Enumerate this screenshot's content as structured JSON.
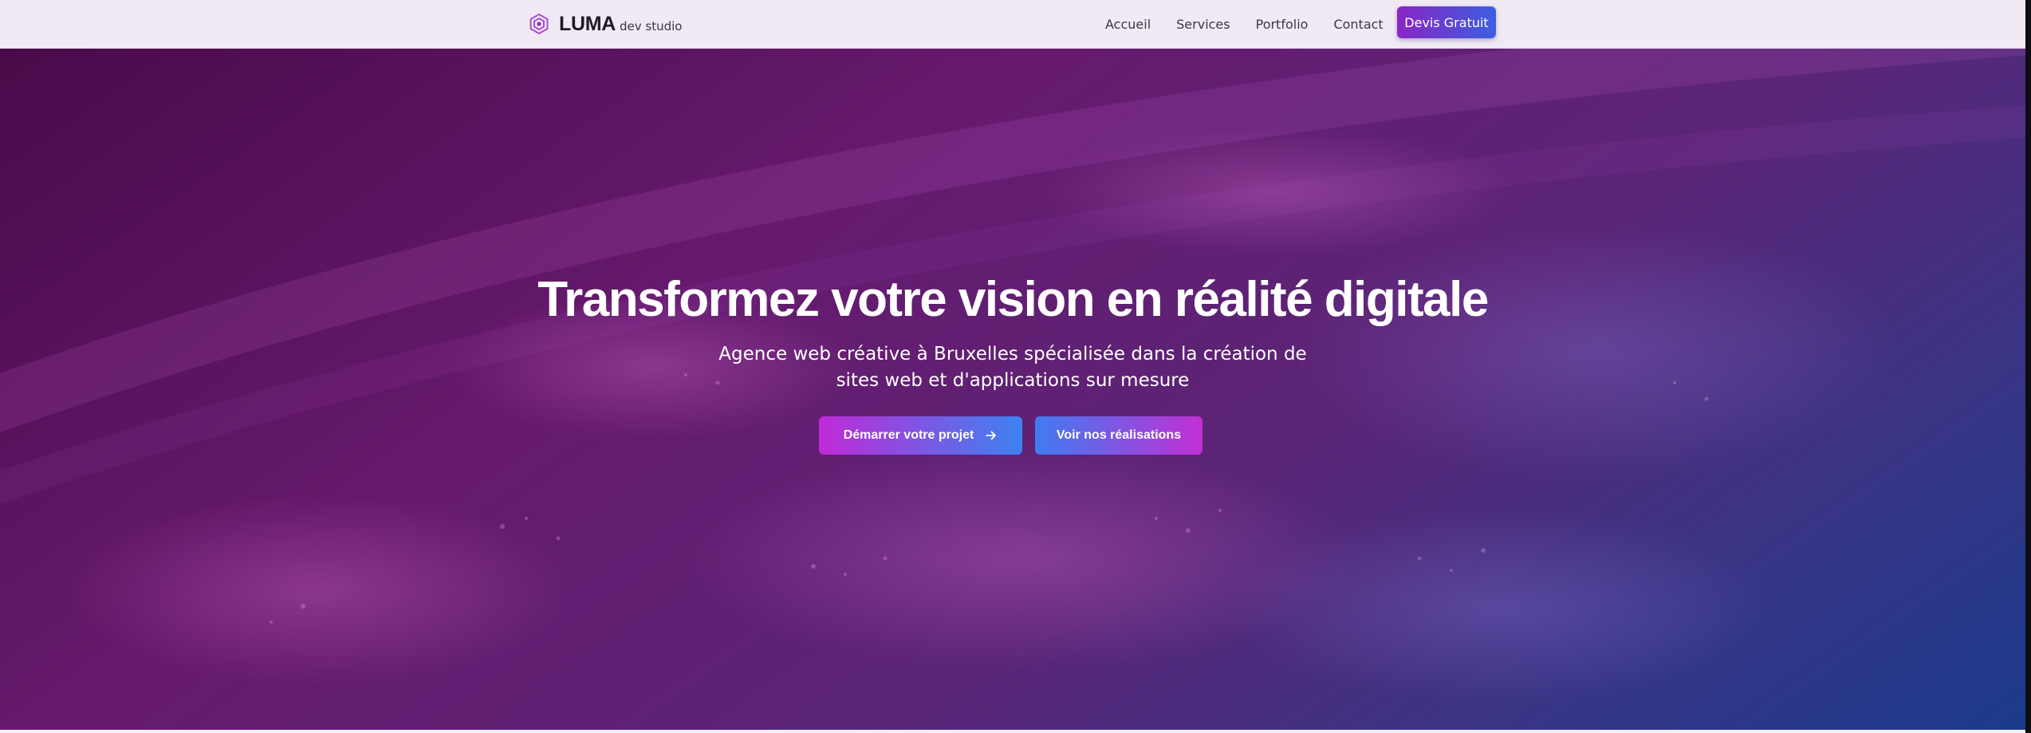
{
  "header": {
    "brand_name": "LUMA",
    "brand_sub": "dev studio",
    "logo_icon": "hexagon-logo-icon",
    "nav": [
      {
        "label": "Accueil"
      },
      {
        "label": "Services"
      },
      {
        "label": "Portfolio"
      },
      {
        "label": "Contact"
      }
    ],
    "cta_label": "Devis Gratuit"
  },
  "hero": {
    "title": "Transformez votre vision en réalité digitale",
    "subtitle": "Agence web créative à Bruxelles spécialisée dans la création de sites web et d'applications sur mesure",
    "primary_button": {
      "label": "Démarrer votre projet",
      "icon": "arrow-right-icon"
    },
    "secondary_button": {
      "label": "Voir nos réalisations"
    }
  },
  "colors": {
    "accent_purple": "#8a25c4",
    "accent_blue": "#3b5fe0",
    "hero_start": "#4a0a49",
    "hero_end": "#1b3a8c",
    "nav_background": "#f1e9f3"
  }
}
